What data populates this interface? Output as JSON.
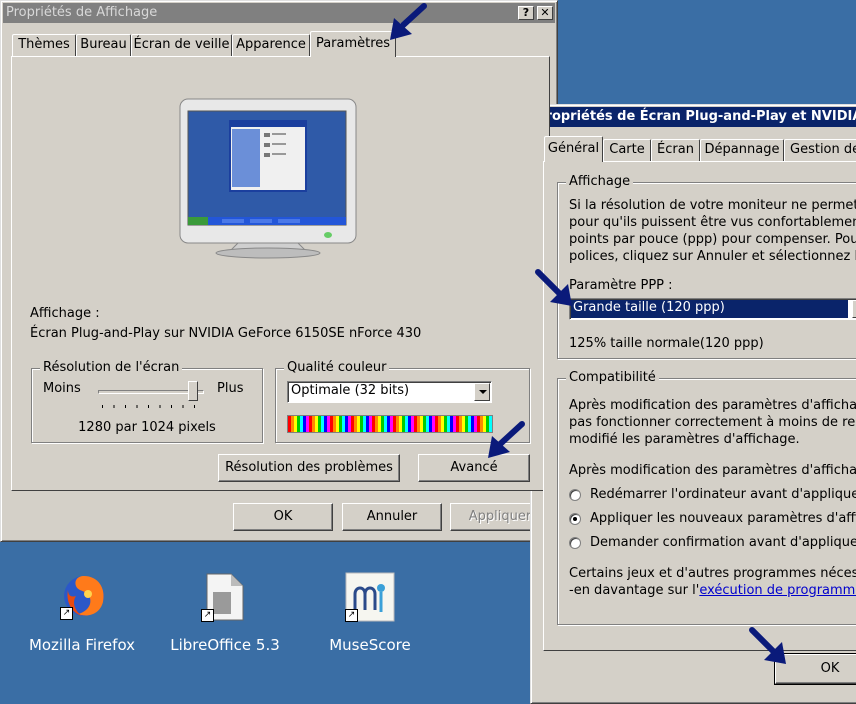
{
  "display_props": {
    "title": "Propriétés de Affichage",
    "help_btn": "?",
    "close_btn": "✕",
    "tabs": [
      "Thèmes",
      "Bureau",
      "Écran de veille",
      "Apparence",
      "Paramètres"
    ],
    "display_label": "Affichage :",
    "display_value": "Écran Plug-and-Play sur NVIDIA GeForce 6150SE nForce 430",
    "resolution": {
      "label": "Résolution de l'écran",
      "less": "Moins",
      "more": "Plus",
      "value": "1280 par 1024 pixels",
      "slider_level": 1.0
    },
    "color_quality": {
      "label": "Qualité couleur",
      "selected": "Optimale (32 bits)"
    },
    "troubleshoot_btn": "Résolution des problèmes",
    "advanced_btn": "Avancé",
    "ok_btn": "OK",
    "cancel_btn": "Annuler",
    "apply_btn": "Appliquer"
  },
  "monitor_props": {
    "title": "Propriétés de Écran Plug-and-Play et NVIDIA G",
    "tabs": [
      "Général",
      "Carte",
      "Écran",
      "Dépannage",
      "Gestion de"
    ],
    "display_group": {
      "label": "Affichage",
      "lines": [
        "Si la résolution de votre moniteur ne permet pas d",
        "pour qu'ils puissent être vus confortablement, vou",
        "points par pouce (ppp) pour compenser. Pour ne",
        "polices, cliquez sur Annuler et sélectionnez l'ongl"
      ],
      "dpi_label": "Paramètre PPP :",
      "dpi_selected": "Grande taille (120 ppp)",
      "dpi_note": "125% taille normale(120 ppp)"
    },
    "compat_group": {
      "label": "Compatibilité",
      "lines": [
        "Après modification des paramètres d'affichage, c",
        "pas fonctionner correctement à moins de redéma",
        "modifié les paramètres d'affichage."
      ],
      "question": "Après modification des paramètres d'affichage :",
      "options": [
        {
          "label": "Redémarrer l'ordinateur avant d'appliquer les",
          "selected": false
        },
        {
          "label": "Appliquer les nouveaux paramètres d'affichac",
          "selected": true
        },
        {
          "label": "Demander confirmation avant d'appliquer les",
          "selected": false
        }
      ],
      "footer_line1": "Certains jeux et d'autres programmes nécessiten",
      "footer_line2_prefix": "-en davantage sur l'",
      "footer_link": "exécution de programmes er"
    },
    "ok_btn": "OK"
  },
  "desktop": {
    "icons": [
      {
        "name": "firefox-icon",
        "label": "Mozilla Firefox"
      },
      {
        "name": "libreoffice-icon",
        "label": "LibreOffice 5.3"
      },
      {
        "name": "musescore-icon",
        "label": "MuseScore"
      }
    ]
  },
  "colors": {
    "desktop": "#3a6ea5",
    "window_face": "#d4d0c8",
    "active_title": "#0a246a",
    "inactive_title": "#808080",
    "annotation_arrow": "#0a1a7a",
    "selection": "#0a246a"
  }
}
